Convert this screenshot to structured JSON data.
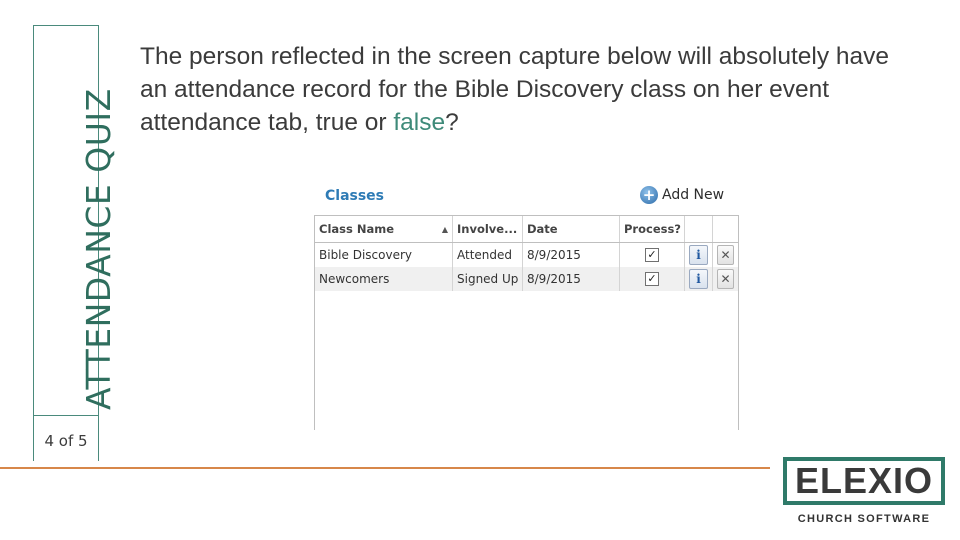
{
  "sidebar": {
    "title": "ATTENDANCE QUIZ",
    "page_indicator": "4 of 5"
  },
  "question": {
    "text_before": "The person reflected in the screen capture below will absolutely have an attendance record for the Bible Discovery class on her event attendance tab, true or ",
    "answer": "false",
    "text_after": "?"
  },
  "panel": {
    "title": "Classes",
    "add_new_label": "Add New",
    "columns": [
      "Class Name",
      "Involve...",
      "Date",
      "Process?"
    ],
    "rows": [
      {
        "class_name": "Bible Discovery",
        "involvement": "Attended",
        "date": "8/9/2015",
        "process": "✓"
      },
      {
        "class_name": "Newcomers",
        "involvement": "Signed Up",
        "date": "8/9/2015",
        "process": "✓"
      }
    ]
  },
  "logo": {
    "text": "ELEXIO",
    "subtitle": "CHURCH SOFTWARE"
  },
  "colors": {
    "accent_green": "#2f7a69",
    "accent_orange": "#d7874a",
    "link_blue": "#2e7bb5"
  }
}
